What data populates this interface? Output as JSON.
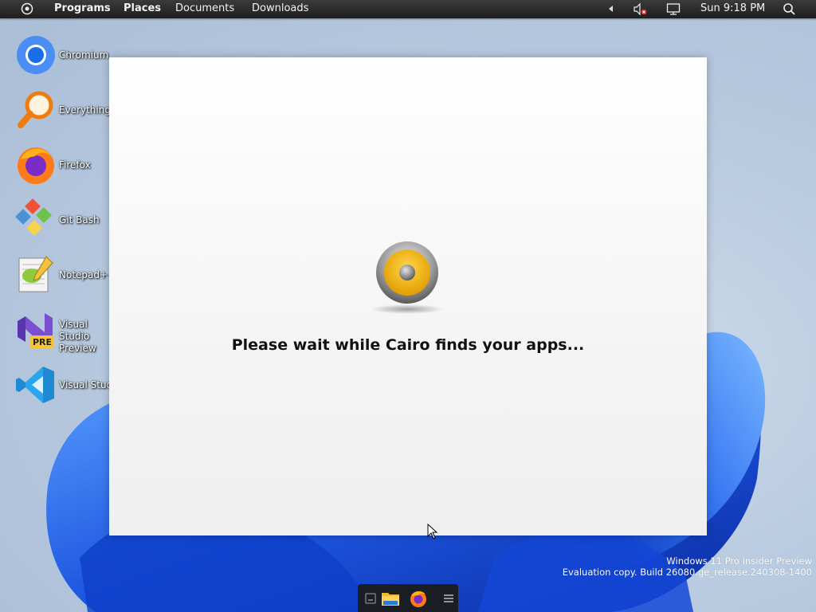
{
  "menubar": {
    "items": [
      "Programs",
      "Places",
      "Documents",
      "Downloads"
    ],
    "clock": "Sun 9:18 PM"
  },
  "desktop": {
    "icons": [
      {
        "label": "Chromium",
        "icon": "chromium-icon"
      },
      {
        "label": "Everything",
        "icon": "everything-search-icon"
      },
      {
        "label": "Firefox",
        "icon": "firefox-icon"
      },
      {
        "label": "Git Bash",
        "icon": "git-bash-icon"
      },
      {
        "label": "Notepad++",
        "icon": "notepad-plus-plus-icon"
      },
      {
        "label": "Visual Studio Preview",
        "icon": "visual-studio-preview-icon",
        "badge": "PRE"
      },
      {
        "label": "Visual Studio",
        "icon": "vscode-icon"
      }
    ]
  },
  "splash": {
    "message": "Please wait while Cairo finds your apps..."
  },
  "watermark": {
    "line1": "Windows 11 Pro Insider Preview",
    "line2": "Evaluation copy. Build 26080.ge_release.240308-1400"
  },
  "taskbar": {
    "items": [
      "show-desktop-icon",
      "file-explorer-icon",
      "firefox-icon",
      "menu-icon"
    ]
  },
  "colors": {
    "menubar": "#2a2a2a",
    "wallpaper_blue": "#1f5fe0",
    "splash_logo_yellow": "#f2b810"
  }
}
